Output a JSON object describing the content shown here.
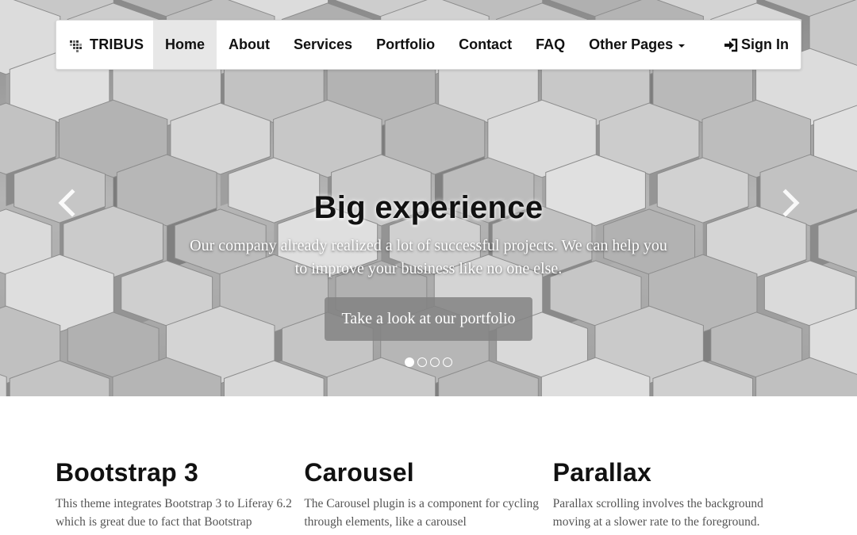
{
  "navbar": {
    "brand": "TRIBUS",
    "brand_icon": "pixel-logo-icon",
    "links": [
      {
        "label": "Home",
        "active": true
      },
      {
        "label": "About"
      },
      {
        "label": "Services"
      },
      {
        "label": "Portfolio"
      },
      {
        "label": "Contact"
      },
      {
        "label": "FAQ"
      },
      {
        "label": "Other Pages",
        "dropdown": true
      }
    ],
    "signin": {
      "label": "Sign In",
      "icon": "sign-in-icon"
    }
  },
  "carousel": {
    "title": "Big experience",
    "text": "Our company already realized a lot of successful projects. We can help you to improve your business like no one else.",
    "button_label": "Take a look at our portfolio",
    "slide_count": 4,
    "active_slide": 1,
    "prev_icon": "chevron-left-icon",
    "next_icon": "chevron-right-icon"
  },
  "features": [
    {
      "title": "Bootstrap 3",
      "text": "This theme integrates Bootstrap 3 to Liferay 6.2 which is great due to fact that Bootstrap"
    },
    {
      "title": "Carousel",
      "text": "The Carousel plugin is a component for cycling through elements, like a carousel"
    },
    {
      "title": "Parallax",
      "text": "Parallax scrolling involves the background moving at a slower rate to the foreground."
    }
  ],
  "colors": {
    "active_nav_bg": "#e7e7e7",
    "cta_bg": "#828282",
    "body_text": "#555555"
  }
}
